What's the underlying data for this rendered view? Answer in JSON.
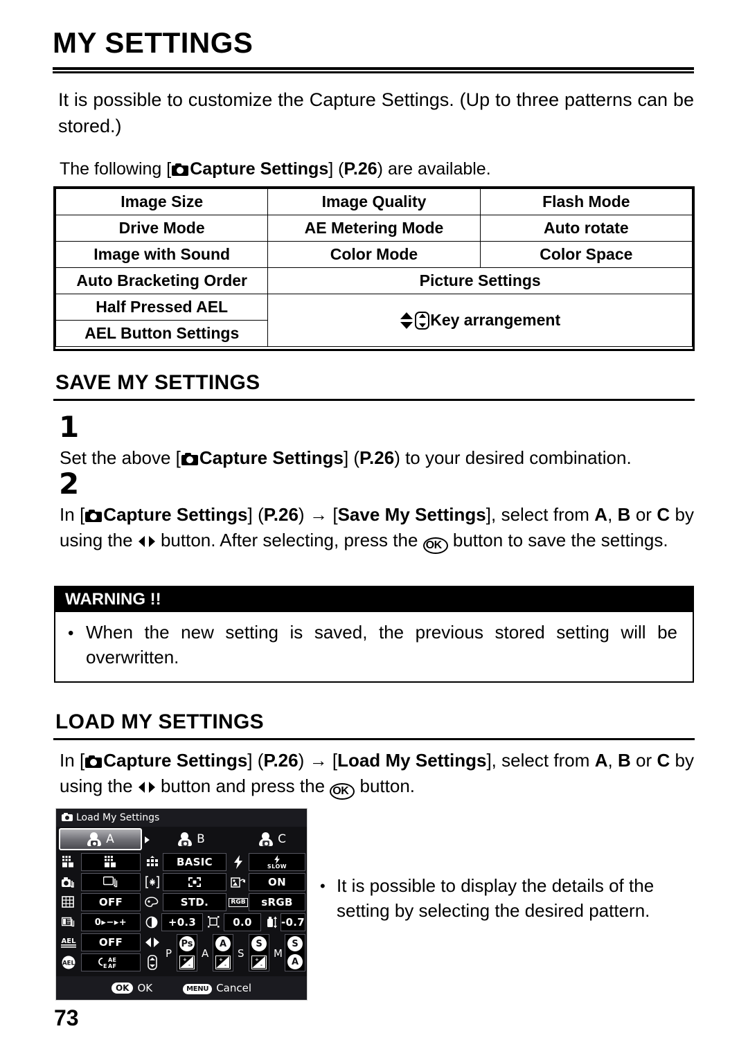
{
  "document": {
    "title": "MY SETTINGS",
    "page_number": "73"
  },
  "intro": {
    "paragraph": "It is possible to customize the Capture Settings. (Up to three patterns can be stored.)",
    "following_prefix": "The following [",
    "capture_settings": "Capture Settings",
    "following_mid": "] (",
    "page_ref": "P.26",
    "following_suffix": ") are available."
  },
  "settings_table": {
    "rows": [
      [
        "Image Size",
        "Image Quality",
        "Flash Mode"
      ],
      [
        "Drive Mode",
        "AE Metering Mode",
        "Auto rotate"
      ],
      [
        "Image with Sound",
        "Color Mode",
        "Color Space"
      ]
    ],
    "row4": {
      "left": "Auto Bracketing Order",
      "right": "Picture Settings"
    },
    "row5": {
      "left": "Half Pressed AEL"
    },
    "row6": {
      "left": "AEL Button Settings"
    },
    "key_arrangement": "Key arrangement"
  },
  "save_section": {
    "heading": "SAVE MY SETTINGS",
    "step1_num": "1",
    "step1_a": "Set the above [",
    "step1_b": "Capture Settings",
    "step1_c": "] (",
    "step1_pref": "P.26",
    "step1_d": ") to your desired combination.",
    "step2_num": "2",
    "step2_a": "In [",
    "step2_b": "Capture Settings",
    "step2_c": "] (",
    "step2_pref": "P.26",
    "step2_d": ") ",
    "step2_arrow": "→",
    "step2_e": " [",
    "step2_target": "Save My Settings",
    "step2_f": "], select from ",
    "opt_a": "A",
    "opt_comma": ", ",
    "opt_b": "B",
    "opt_or": " or ",
    "opt_c": "C",
    "step2_g": " by using the ",
    "step2_h": " button. After selecting, press the ",
    "ok_label": "OK",
    "step2_i": " button to save the settings."
  },
  "warning": {
    "heading": "WARNING !!",
    "bullet": "•",
    "text": "When the new setting is saved, the previous stored setting will be overwritten."
  },
  "load_section": {
    "heading": "LOAD MY SETTINGS",
    "a": "In [",
    "b": "Capture Settings",
    "c": "] (",
    "page_ref": "P.26",
    "d": ") ",
    "arrow": "→",
    "e": " [",
    "target": "Load My Settings",
    "f": "], select from ",
    "opt_a": "A",
    "opt_comma": ", ",
    "opt_b": "B",
    "opt_or": " or ",
    "opt_c": "C",
    "g": " by using the ",
    "h": " button and press the ",
    "ok_label": "OK",
    "i": " button."
  },
  "side_note": {
    "bullet": "•",
    "text": "It is possible to display the details of the setting by selecting the desired pattern."
  },
  "lcd": {
    "title": "Load My Settings",
    "tabs": [
      {
        "label": "A",
        "selected": true
      },
      {
        "label": "B",
        "selected": false
      },
      {
        "label": "C",
        "selected": false
      }
    ],
    "values": {
      "image_quality": "BASIC",
      "flash_mode": "SLOW",
      "auto_rotate": "ON",
      "color_space": "sRGB",
      "image_with_sound": "OFF",
      "color_mode": "STD.",
      "auto_bracketing_order": "0▸−▸+",
      "contrast": "+0.3",
      "sharpness": "0.0",
      "color_density": "-0.7",
      "half_pressed_ael": "OFF",
      "ael_button": "CAE EAF"
    },
    "modes": [
      {
        "letter": "P",
        "top": "Ps",
        "bottom": "exposure-comp"
      },
      {
        "letter": "A",
        "top": "A",
        "bottom": "exposure-comp"
      },
      {
        "letter": "S",
        "top": "S",
        "bottom": "exposure-comp"
      },
      {
        "letter": "M",
        "top": "S",
        "bottom": "A"
      }
    ],
    "footer": {
      "ok_pill": "OK",
      "ok_label": "OK",
      "menu_pill": "MENU",
      "cancel_label": "Cancel"
    }
  }
}
